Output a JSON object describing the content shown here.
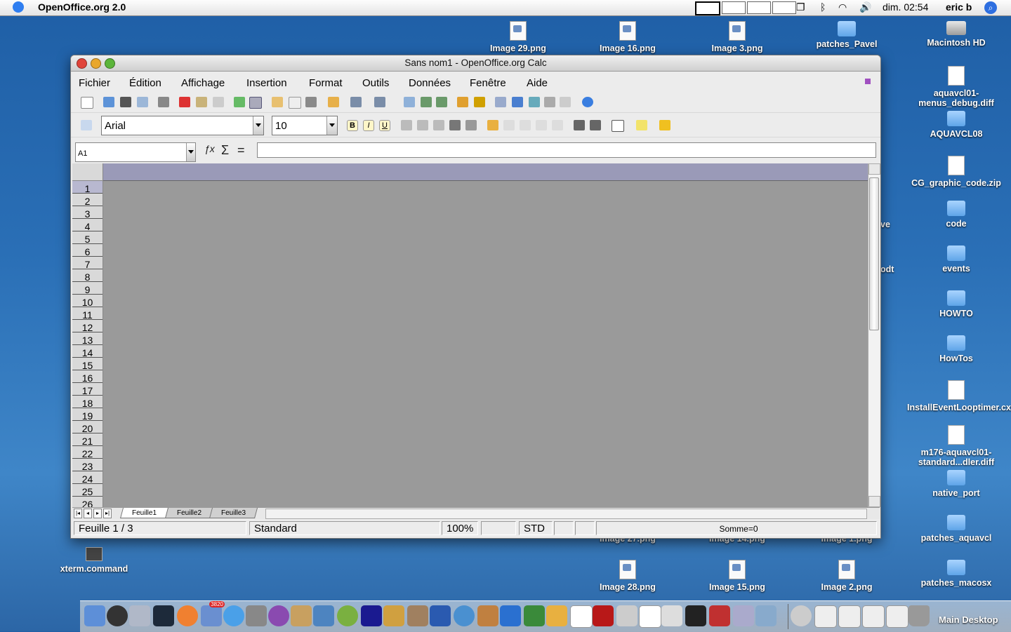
{
  "menubar": {
    "app_name": "OpenOffice.org 2.0",
    "clock": "dim. 02:54",
    "user": "eric b"
  },
  "desktop_icons": [
    {
      "label": "Image 29.png",
      "type": "png"
    },
    {
      "label": "Image 16.png",
      "type": "png"
    },
    {
      "label": "Image 3.png",
      "type": "png"
    },
    {
      "label": "patches_Pavel",
      "type": "folder"
    },
    {
      "label": "Macintosh HD",
      "type": "disk"
    },
    {
      "label": "aquavcl01-menus_debug.diff",
      "type": "doc"
    },
    {
      "label": "AQUAVCL08",
      "type": "folder"
    },
    {
      "label": "CG_graphic_code.zip",
      "type": "doc"
    },
    {
      "label": "code",
      "type": "folder"
    },
    {
      "label": "events",
      "type": "folder"
    },
    {
      "label": "HOWTO",
      "type": "folder"
    },
    {
      "label": "HowTos",
      "type": "folder"
    },
    {
      "label": "InstallEventLooptimer.cxx",
      "type": "doc"
    },
    {
      "label": "m176-aquavcl01-standard...dler.diff",
      "type": "doc"
    },
    {
      "label": "native_port",
      "type": "folder"
    },
    {
      "label": "patches_aquavcl",
      "type": "folder"
    },
    {
      "label": "patches_macosx",
      "type": "folder"
    },
    {
      "label": "Image 28.png",
      "type": "png"
    },
    {
      "label": "Image 15.png",
      "type": "png"
    },
    {
      "label": "Image 2.png",
      "type": "png"
    },
    {
      "label": "xterm.command",
      "type": "doc"
    },
    {
      "label": "Image 27.png",
      "type": "png"
    },
    {
      "label": "Image 14.png",
      "type": "png"
    },
    {
      "label": "Image 1.png",
      "type": "png"
    },
    {
      "label": "ve",
      "type": "partial"
    },
    {
      "label": "odt",
      "type": "partial"
    }
  ],
  "window": {
    "title": "Sans nom1 - OpenOffice.org Calc",
    "menu": [
      "Fichier",
      "Édition",
      "Affichage",
      "Insertion",
      "Format",
      "Outils",
      "Données",
      "Fenêtre",
      "Aide"
    ],
    "font_name": "Arial",
    "font_size": "10",
    "name_box": "A1",
    "formula_value": "",
    "format_buttons": {
      "bold": "B",
      "italic": "I",
      "underline": "U"
    },
    "row_numbers": [
      "1",
      "2",
      "3",
      "4",
      "5",
      "6",
      "7",
      "8",
      "9",
      "10",
      "11",
      "12",
      "13",
      "14",
      "15",
      "16",
      "17",
      "18",
      "19",
      "20",
      "21",
      "22",
      "23",
      "24",
      "25",
      "26"
    ],
    "sheet_tabs": [
      "Feuille1",
      "Feuille2",
      "Feuille3"
    ],
    "active_tab": "Feuille1",
    "status": {
      "sheet": "Feuille 1 / 3",
      "page_style": "Standard",
      "zoom": "100%",
      "mode": "STD",
      "sum": "Somme=0"
    }
  },
  "dock": {
    "label": "Main Desktop",
    "badge": "3820"
  },
  "colors": {
    "desktop": "#2a6fb6",
    "grid_bg": "#9a9a9a",
    "column_header": "#9a9ab8",
    "selected_row": "#b8b8d0"
  }
}
